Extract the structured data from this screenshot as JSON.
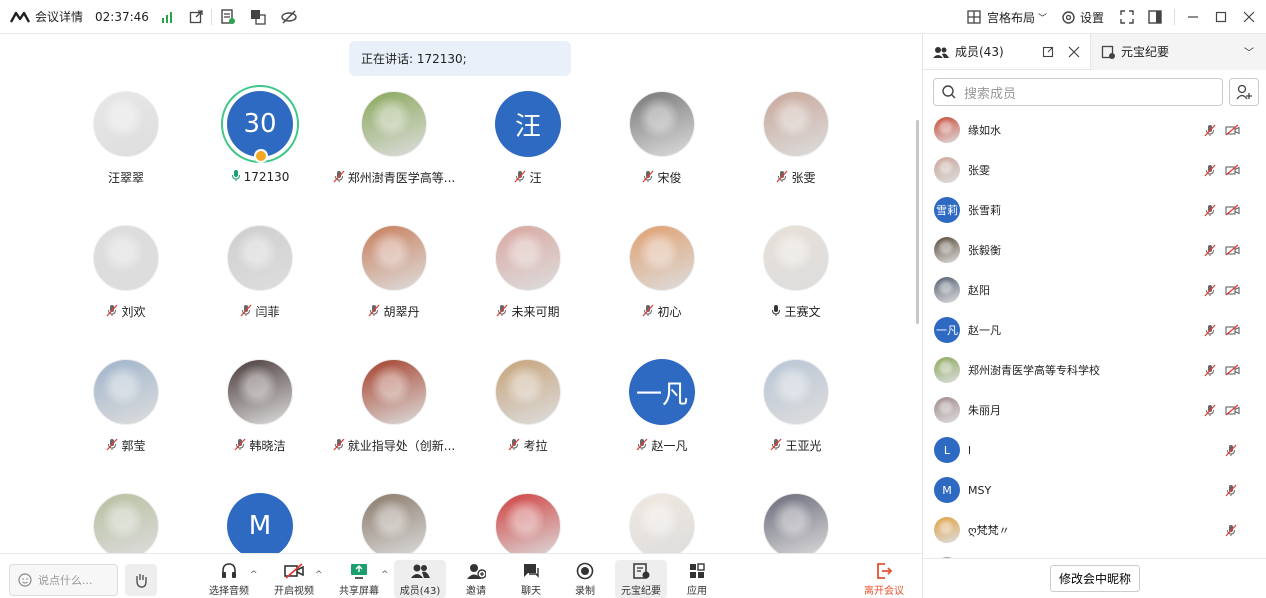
{
  "top": {
    "app_title": "会议详情",
    "time": "02:37:46",
    "layout_label": "宫格布局",
    "settings_label": "设置"
  },
  "speaking": "正在讲话: 172130;",
  "tiles": [
    {
      "name": "汪翠翠",
      "mic": "none",
      "avatar": "photo",
      "color": "#e8e8e8"
    },
    {
      "name": "172130",
      "mic": "active",
      "avatar": "text",
      "text": "30",
      "color": "#2e6ac1",
      "ring": true
    },
    {
      "name": "郑州澍青医学高等...",
      "mic": "off",
      "avatar": "photo",
      "color": "#8aa85a"
    },
    {
      "name": "汪",
      "mic": "off",
      "avatar": "text",
      "text": "汪",
      "color": "#2e6ac1"
    },
    {
      "name": "宋俊",
      "mic": "off",
      "avatar": "photo",
      "color": "#777"
    },
    {
      "name": "张雯",
      "mic": "off",
      "avatar": "photo",
      "color": "#c9a79a"
    },
    {
      "name": "刘欢",
      "mic": "off",
      "avatar": "photo",
      "color": "#ddd"
    },
    {
      "name": "闫菲",
      "mic": "off",
      "avatar": "photo",
      "color": "#cfcfcf"
    },
    {
      "name": "胡翠丹",
      "mic": "off",
      "avatar": "photo",
      "color": "#c97e5c"
    },
    {
      "name": "未来可期",
      "mic": "off",
      "avatar": "photo",
      "color": "#d9a7a0"
    },
    {
      "name": "初心",
      "mic": "off",
      "avatar": "photo",
      "color": "#e0a070"
    },
    {
      "name": "王赛文",
      "mic": "on",
      "avatar": "photo",
      "color": "#e8e0d8"
    },
    {
      "name": "郭莹",
      "mic": "off",
      "avatar": "photo",
      "color": "#9fb4cc"
    },
    {
      "name": "韩晓洁",
      "mic": "off",
      "avatar": "photo",
      "color": "#4a3a3a"
    },
    {
      "name": "就业指导处（创新...",
      "mic": "off",
      "avatar": "photo",
      "color": "#a5402a"
    },
    {
      "name": "考拉",
      "mic": "off",
      "avatar": "photo",
      "color": "#c7a37a"
    },
    {
      "name": "赵一凡",
      "mic": "off",
      "avatar": "text",
      "text": "一凡",
      "color": "#2e6ac1"
    },
    {
      "name": "王亚光",
      "mic": "off",
      "avatar": "photo",
      "color": "#b9c6d6"
    },
    {
      "name": "",
      "mic": "none",
      "avatar": "photo",
      "color": "#b8c0a0"
    },
    {
      "name": "",
      "mic": "none",
      "avatar": "text",
      "text": "M",
      "color": "#2e6ac1"
    },
    {
      "name": "",
      "mic": "none",
      "avatar": "photo",
      "color": "#8a7a6a"
    },
    {
      "name": "",
      "mic": "none",
      "avatar": "photo",
      "color": "#d04040"
    },
    {
      "name": "",
      "mic": "none",
      "avatar": "photo",
      "color": "#f0e8e0"
    },
    {
      "name": "",
      "mic": "none",
      "avatar": "photo",
      "color": "#6a6a7a"
    }
  ],
  "side": {
    "tab_members": "成员(43)",
    "tab_summary": "元宝纪要",
    "search_placeholder": "搜索成员",
    "nick_button": "修改会中昵称"
  },
  "members": [
    {
      "name": "缘如水",
      "avatar": "photo",
      "color": "#c84a3a",
      "cam": true
    },
    {
      "name": "张雯",
      "avatar": "photo",
      "color": "#c9a79a",
      "cam": true
    },
    {
      "name": "张雪莉",
      "avatar": "text",
      "text": "雪莉",
      "color": "#2e6ac1",
      "cam": true
    },
    {
      "name": "张毅衡",
      "avatar": "photo",
      "color": "#5a4a3a",
      "cam": true
    },
    {
      "name": "赵阳",
      "avatar": "photo",
      "color": "#556070",
      "cam": true
    },
    {
      "name": "赵一凡",
      "avatar": "text",
      "text": "一凡",
      "color": "#2e6ac1",
      "cam": true
    },
    {
      "name": "郑州澍青医学高等专科学校",
      "avatar": "photo",
      "color": "#8aa85a",
      "cam": true
    },
    {
      "name": "朱丽月",
      "avatar": "photo",
      "color": "#a08a8a",
      "cam": true
    },
    {
      "name": "l",
      "avatar": "text",
      "text": "L",
      "color": "#2e6ac1",
      "cam": false
    },
    {
      "name": "MSY",
      "avatar": "text",
      "text": "M",
      "color": "#2e6ac1",
      "cam": false
    },
    {
      "name": "ღ梵梵〃",
      "avatar": "photo",
      "color": "#e0a040",
      "cam": false
    },
    {
      "name": "",
      "avatar": "photo",
      "color": "#a09090",
      "cam": false
    }
  ],
  "bottom": {
    "chat_placeholder": "说点什么...",
    "audio": "选择音频",
    "video": "开启视频",
    "share": "共享屏幕",
    "members": "成员(43)",
    "invite": "邀请",
    "chat": "聊天",
    "record": "录制",
    "summary": "元宝纪要",
    "apps": "应用",
    "leave": "离开会议"
  }
}
